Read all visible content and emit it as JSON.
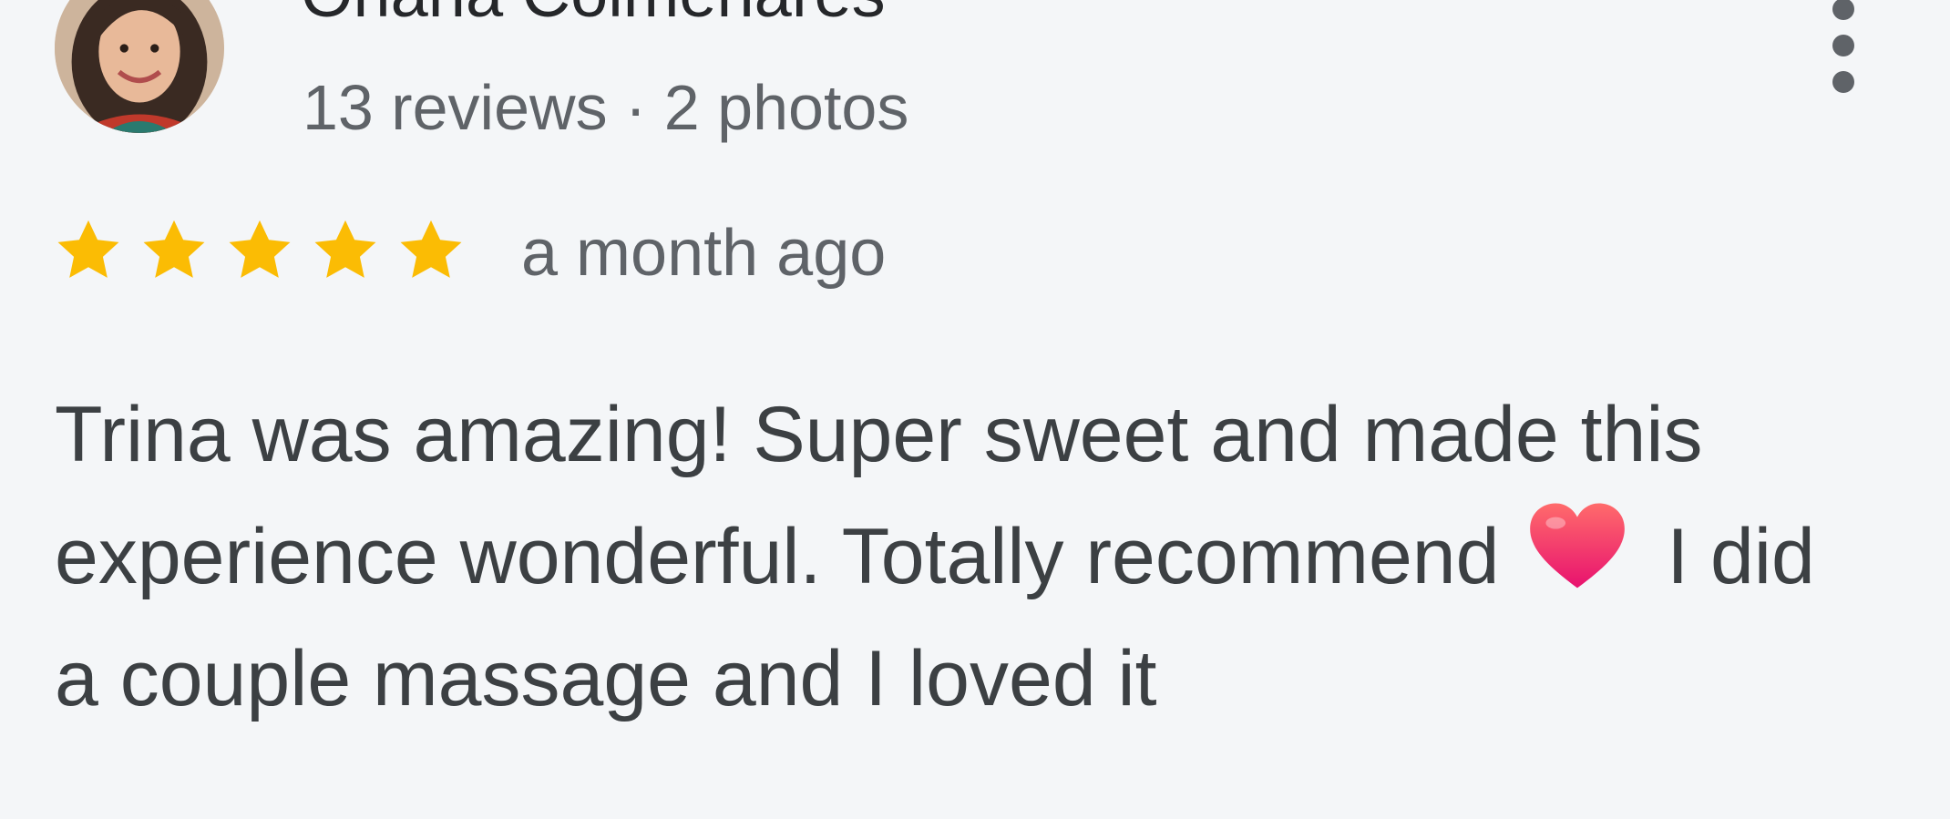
{
  "review": {
    "reviewer_name": "Oriana Colmenares",
    "reviewer_meta": "13 reviews · 2 photos",
    "rating": 5,
    "rating_max": 5,
    "date": "a month ago",
    "text_part1": "Trina was amazing! Super sweet and made this experience wonderful. Totally recommend",
    "text_part2": " I did a couple massage and I loved it",
    "emoji": "heart-icon"
  },
  "icons": {
    "more_menu": "more-vert-icon",
    "star": "star-icon"
  },
  "colors": {
    "background": "#f4f6f8",
    "star": "#fbbc04",
    "heart": "#f0425b",
    "text": "#3c4043",
    "secondary_text": "#5f6368"
  }
}
